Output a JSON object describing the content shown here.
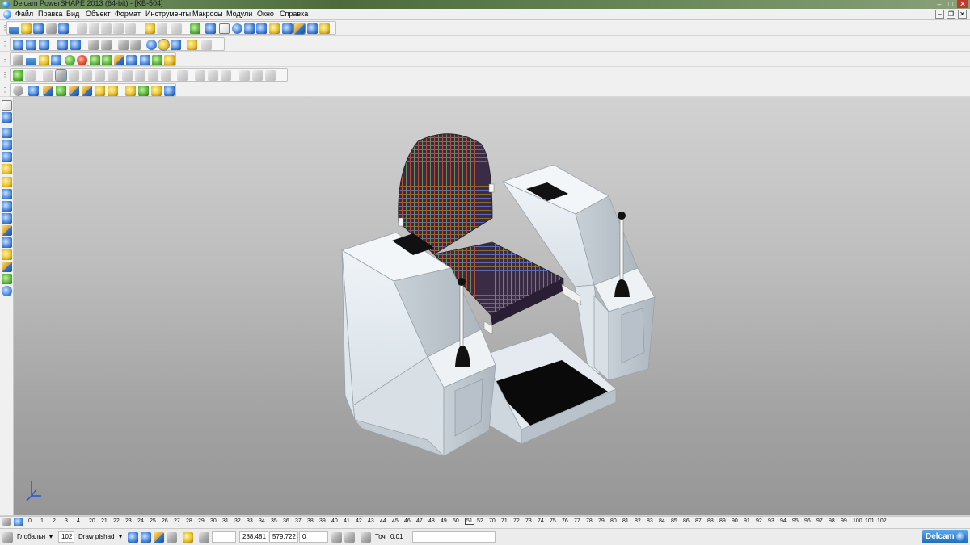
{
  "window": {
    "title": "Delcam PowerSHAPE 2013 (64-bit) - [KB-504]",
    "controls": {
      "minimize": "–",
      "maximize": "□",
      "close": "✕"
    }
  },
  "menubar": {
    "items": [
      "Файл",
      "Правка",
      "Вид",
      "Объект",
      "Формат",
      "Инструменты",
      "Макросы",
      "Модули",
      "Окно",
      "Справка"
    ],
    "mdi_controls": {
      "minimize": "–",
      "restore": "❐",
      "close": "✕"
    }
  },
  "toolbars": {
    "handle_glyph": "⋮",
    "row1_icons": [
      "new-icon",
      "open-icon",
      "save-icon",
      "print-icon",
      "cut-icon",
      "copy-icon",
      "paste-icon",
      "delete-icon",
      "undo-icon",
      "redo-icon",
      "select-icon",
      "arc-icon",
      "circle-icon",
      "line-icon",
      "curve-icon",
      "surface-icon",
      "solid-icon",
      "render-icon"
    ],
    "row2_icons": [
      "zoom-icon",
      "view-icon",
      "shade-icon",
      "wireframe-icon",
      "axis-icon",
      "green-sphere-icon",
      "red-sphere-icon",
      "play-icon",
      "cube-icon",
      "layer-icon"
    ],
    "row3_icons": [
      "view-top-icon",
      "view-front-icon",
      "view-side-icon",
      "view-iso-icon",
      "rotate-icon",
      "pan-icon",
      "fit-icon",
      "box-zoom-icon"
    ],
    "row4_icons": [
      "sphere-icon",
      "measure-icon",
      "analysis-icon",
      "shaded-cube-icon",
      "surface-cube-icon",
      "mesh-icon",
      "texture-icon",
      "curvature-icon",
      "draft-icon"
    ]
  },
  "left_toolbar": {
    "icons": [
      "pointer-icon",
      "select-mode-icon",
      "copy-icon",
      "move-icon",
      "rotate-icon",
      "mirror-icon",
      "scale-icon",
      "solid-icon",
      "surface-icon",
      "curve-icon",
      "text-icon",
      "dimension-icon",
      "workplane-icon",
      "assembly-icon",
      "feature-icon",
      "material-icon"
    ]
  },
  "viewport": {
    "background_top": "#d2d2d2",
    "background_bottom": "#969696",
    "object": "operator-chair-with-joysticks",
    "colors": {
      "console": "#e6ecf1",
      "console_shade": "#c4ccd3",
      "fabric": "#3a2c44",
      "joystick": "#111111",
      "lever": "#f6f6f6",
      "floor_pad": "#0a0a0a"
    }
  },
  "levels_bar": {
    "levels": [
      "0",
      "1",
      "2",
      "3",
      "4",
      "20",
      "21",
      "22",
      "23",
      "24",
      "25",
      "26",
      "27",
      "28",
      "29",
      "30",
      "31",
      "32",
      "33",
      "34",
      "35",
      "36",
      "37",
      "38",
      "39",
      "40",
      "41",
      "42",
      "43",
      "44",
      "45",
      "46",
      "47",
      "48",
      "49",
      "50",
      "51",
      "52",
      "70",
      "71",
      "72",
      "73",
      "74",
      "75",
      "76",
      "77",
      "78",
      "79",
      "80",
      "81",
      "82",
      "83",
      "84",
      "85",
      "86",
      "87",
      "88",
      "89",
      "90",
      "91",
      "92",
      "93",
      "94",
      "95",
      "96",
      "97",
      "98",
      "99",
      "100",
      "101",
      "102"
    ],
    "active_level": "51"
  },
  "statusbar": {
    "workplane": "Глобальн",
    "level_number": "102",
    "level_name": "Draw plshad",
    "coord_x": "288,481",
    "coord_y": "579,722",
    "coord_z": "0",
    "tolerance_label": "Точ",
    "tolerance_value": "0,01",
    "extra_field": "",
    "brand": "Delcam"
  }
}
